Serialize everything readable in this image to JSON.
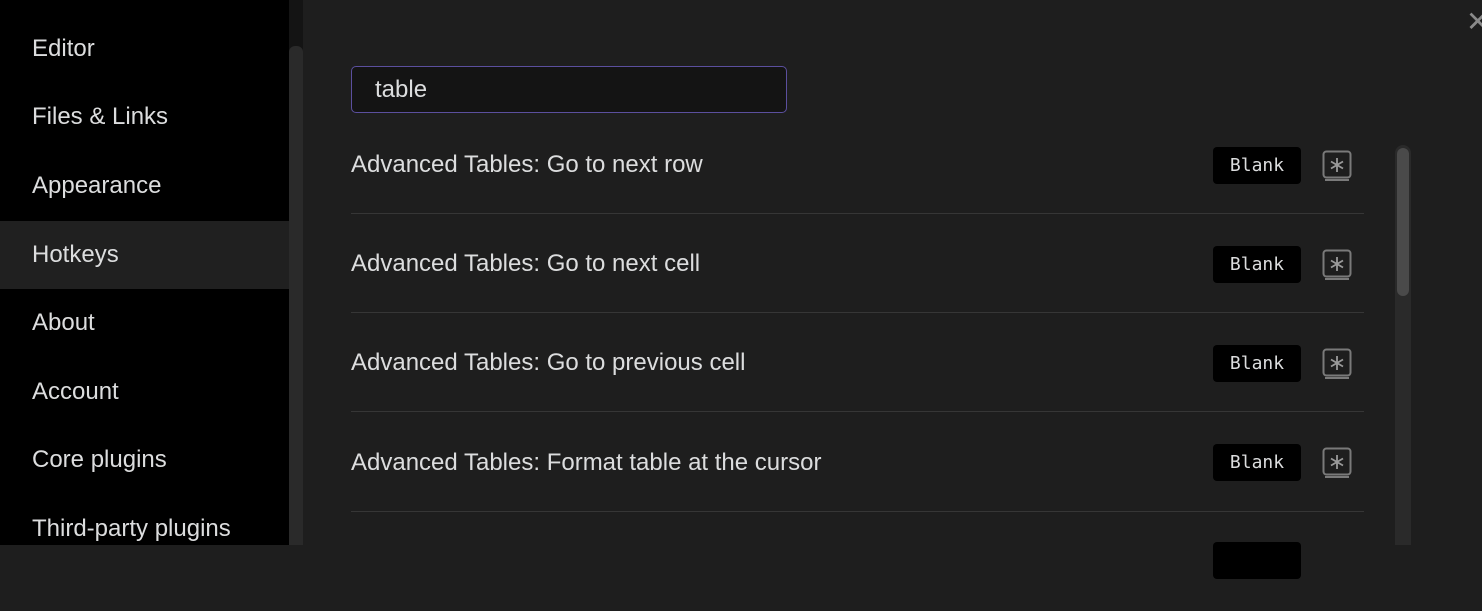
{
  "sidebar": {
    "items": [
      {
        "label": "Editor"
      },
      {
        "label": "Files & Links"
      },
      {
        "label": "Appearance"
      },
      {
        "label": "Hotkeys",
        "active": true
      },
      {
        "label": "About"
      },
      {
        "label": "Account"
      },
      {
        "label": "Core plugins"
      },
      {
        "label": "Third-party plugins"
      }
    ]
  },
  "header": {
    "close_icon": "close-icon"
  },
  "search": {
    "value": "table"
  },
  "hotkeys": {
    "rows": [
      {
        "label": "Advanced Tables: Go to next row",
        "hotkey": "Blank"
      },
      {
        "label": "Advanced Tables: Go to next cell",
        "hotkey": "Blank"
      },
      {
        "label": "Advanced Tables: Go to previous cell",
        "hotkey": "Blank"
      },
      {
        "label": "Advanced Tables: Format table at the cursor",
        "hotkey": "Blank"
      },
      {
        "label": "",
        "hotkey": ""
      }
    ],
    "add_icon": "add-hotkey-icon"
  },
  "colors": {
    "accent": "#5b4f9e",
    "background": "#1e1e1e",
    "sidebar": "#000000",
    "active_item": "#202020"
  }
}
